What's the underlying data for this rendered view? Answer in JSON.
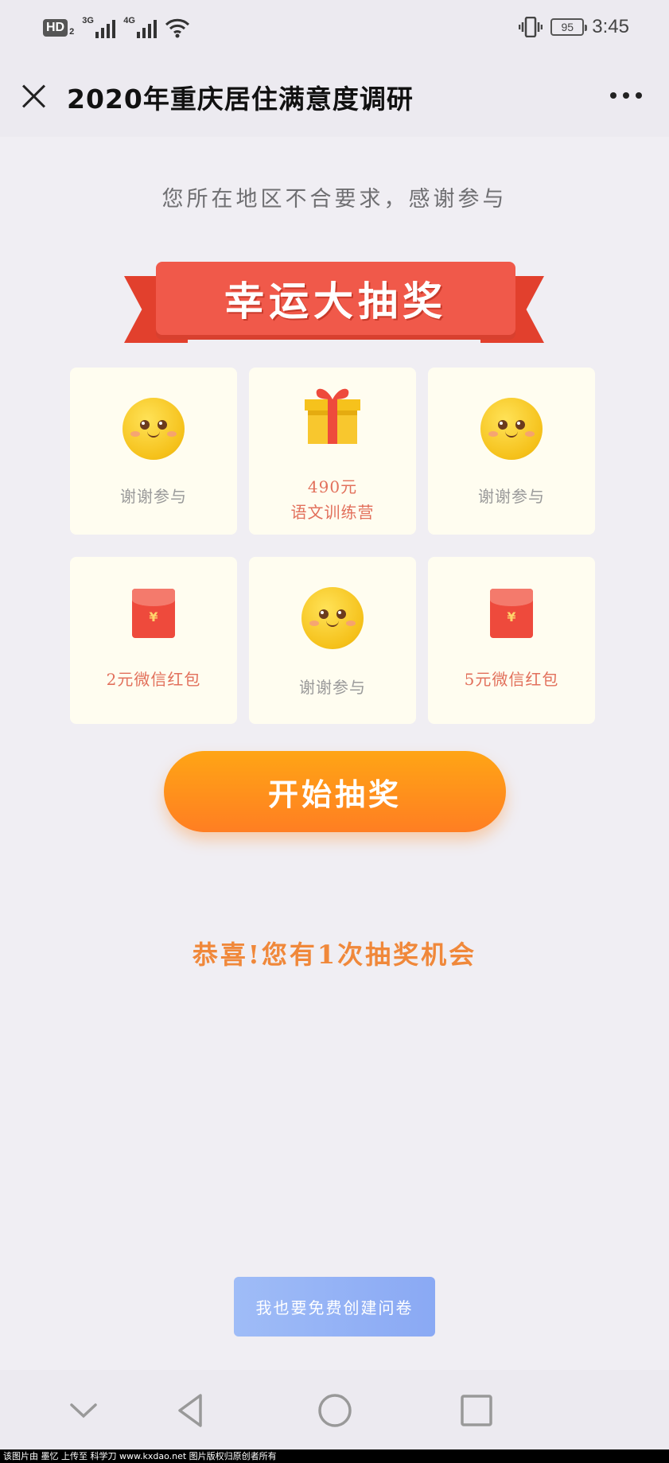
{
  "status_bar": {
    "hd": "HD",
    "hd_sub": "2",
    "net1": "3G",
    "net2": "4G",
    "battery": "95",
    "time": "3:45"
  },
  "header": {
    "title": "2020年重庆居住满意度调研"
  },
  "notice": "您所在地区不合要求，感谢参与",
  "banner": {
    "title": "幸运大抽奖"
  },
  "prizes": [
    {
      "label": "谢谢参与",
      "icon": "smiley-icon"
    },
    {
      "label_line1": "490元",
      "label_line2": "语文训练营",
      "icon": "gift-icon"
    },
    {
      "label": "谢谢参与",
      "icon": "smiley-icon"
    },
    {
      "label": "2元微信红包",
      "icon": "red-envelope-icon",
      "symbol": "¥"
    },
    {
      "label": "谢谢参与",
      "icon": "smiley-icon"
    },
    {
      "label": "5元微信红包",
      "icon": "red-envelope-icon",
      "symbol": "¥"
    }
  ],
  "start_button": "开始抽奖",
  "chance_text": "恭喜!您有1次抽奖机会",
  "create_button": "我也要免费创建问卷",
  "watermark": "该图片由 墨忆 上传至 科学刀 www.kxdao.net 图片版权归原创者所有",
  "colors": {
    "accent_orange": "#ff8c1e",
    "banner_red": "#f0594a",
    "card_bg": "#fffdf0",
    "create_blue": "#8aa9f4"
  }
}
